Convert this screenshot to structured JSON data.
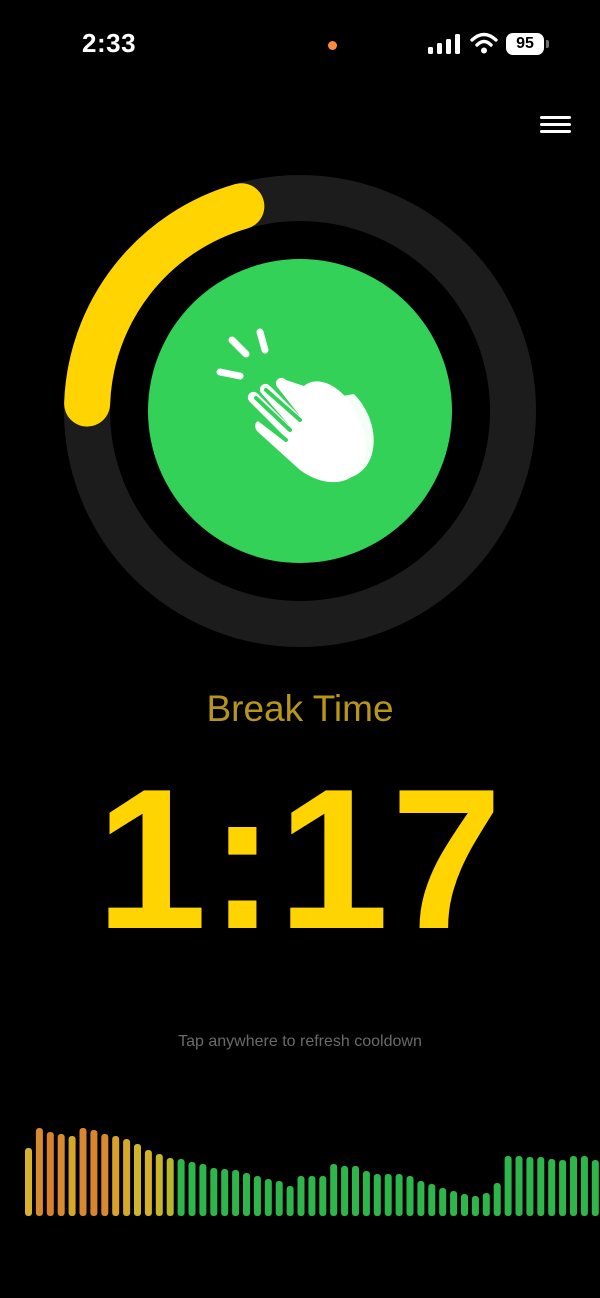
{
  "status_bar": {
    "time": "2:33",
    "battery": "95"
  },
  "timer": {
    "label": "Break Time",
    "countdown": "1:17",
    "progress_fraction": 0.2,
    "accent_color": "#ffd400",
    "circle_color": "#33d157",
    "track_color": "#1c1c1c"
  },
  "hint": "Tap anywhere to refresh cooldown",
  "visualizer": {
    "levels": [
      0.68,
      0.88,
      0.84,
      0.82,
      0.8,
      0.88,
      0.86,
      0.82,
      0.8,
      0.77,
      0.72,
      0.66,
      0.62,
      0.58,
      0.57,
      0.54,
      0.52,
      0.48,
      0.47,
      0.46,
      0.43,
      0.4,
      0.37,
      0.35,
      0.3,
      0.4,
      0.4,
      0.4,
      0.52,
      0.5,
      0.5,
      0.45,
      0.42,
      0.42,
      0.42,
      0.4,
      0.35,
      0.32,
      0.28,
      0.25,
      0.22,
      0.2,
      0.23,
      0.33,
      0.6,
      0.6,
      0.59,
      0.59,
      0.57,
      0.56,
      0.6,
      0.6,
      0.56
    ],
    "colors": [
      "#d8b22a",
      "#d88a30",
      "#d8812d",
      "#d98a2e",
      "#d6a82a",
      "#d98730",
      "#d98530",
      "#d98a30",
      "#d9a02c",
      "#d6a82a",
      "#cfb52a",
      "#d5b02a",
      "#c9b529",
      "#b7b727",
      "#2fb64b"
    ]
  }
}
